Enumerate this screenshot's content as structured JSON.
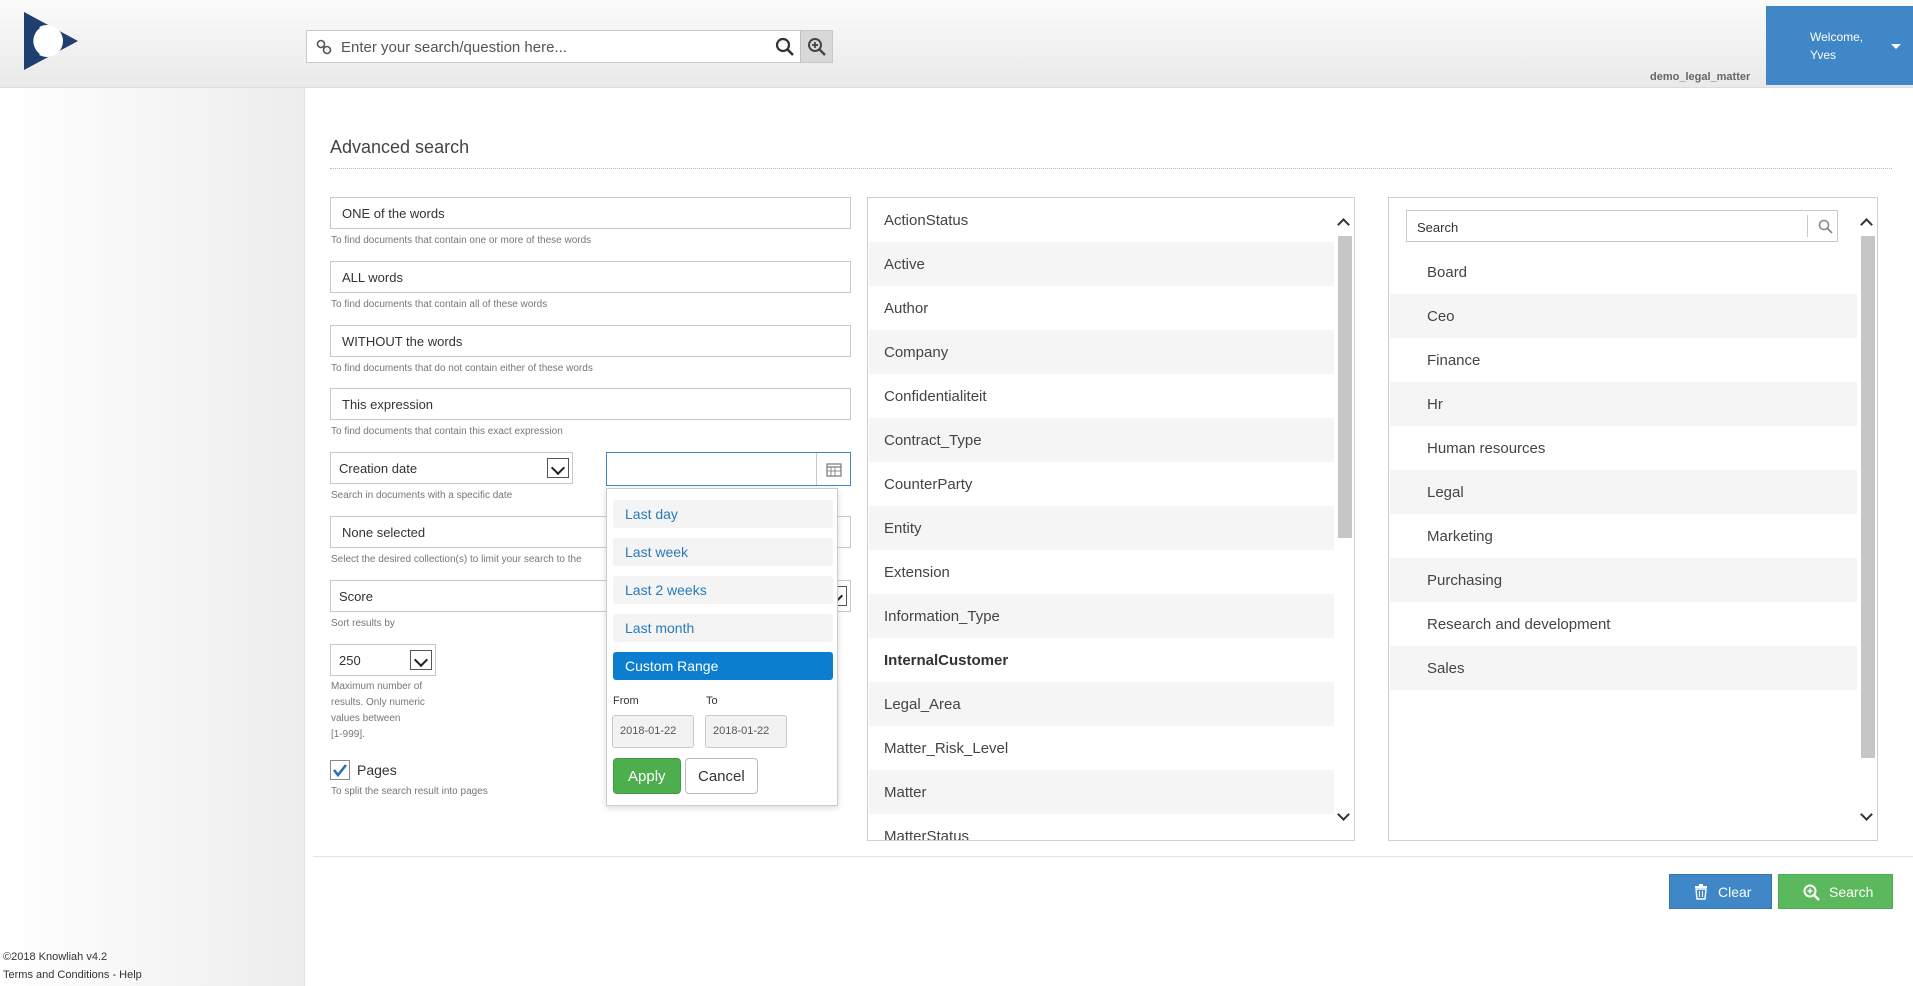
{
  "header": {
    "search_placeholder": "Enter your search/question here...",
    "tenant": "demo_legal_matter",
    "welcome": "Welcome,",
    "username": "Yves"
  },
  "footer": {
    "copyright": "©2018 Knowliah v4.2",
    "links": "Terms and Conditions - Help"
  },
  "form": {
    "title": "Advanced search",
    "one_of_words": "ONE of the words",
    "one_of_words_hint": "To find documents that contain one or more of these words",
    "all_words": "ALL words",
    "all_words_hint": "To find documents that contain all of these words",
    "without_words": "WITHOUT the words",
    "without_words_hint": "To find documents that do not contain either of these words",
    "expression": "This expression",
    "expression_hint": "To find documents that contain this exact expression",
    "date_field": "Creation date",
    "date_hint": "Search in documents with a specific date",
    "collection": "None selected",
    "collection_hint": "Select the desired collection(s) to limit your search to the",
    "sort": "Score",
    "sort_hint": "Sort results by",
    "max_results": "250",
    "max_hint_1": "Maximum number of",
    "max_hint_2": "results. Only numeric",
    "max_hint_3": "values between",
    "max_hint_4": "[1-999].",
    "pages_label": "Pages",
    "pages_checked": true,
    "pages_hint": "To split the search result into pages"
  },
  "date_picker": {
    "ranges": [
      "Last day",
      "Last week",
      "Last 2 weeks",
      "Last month",
      "Custom Range"
    ],
    "active_range": "Custom Range",
    "from_label": "From",
    "to_label": "To",
    "from_value": "2018-01-22",
    "to_value": "2018-01-22",
    "apply": "Apply",
    "cancel": "Cancel"
  },
  "fields_list": [
    "ActionStatus",
    "Active",
    "Author",
    "Company",
    "Confidentialiteit",
    "Contract_Type",
    "CounterParty",
    "Entity",
    "Extension",
    "Information_Type",
    "InternalCustomer",
    "Legal_Area",
    "Matter_Risk_Level",
    "Matter",
    "MatterStatus"
  ],
  "fields_selected": "InternalCustomer",
  "values_panel": {
    "search_placeholder": "Search",
    "items": [
      "Board",
      "Ceo",
      "Finance",
      "Hr",
      "Human resources",
      "Legal",
      "Marketing",
      "Purchasing",
      "Research and development",
      "Sales"
    ]
  },
  "actions": {
    "clear": "Clear",
    "search": "Search"
  },
  "colors": {
    "primary_blue": "#3f87c6",
    "active_range_blue": "#0c7ed0",
    "success_green": "#5cb85c",
    "logo_navy": "#1f3f6e"
  }
}
